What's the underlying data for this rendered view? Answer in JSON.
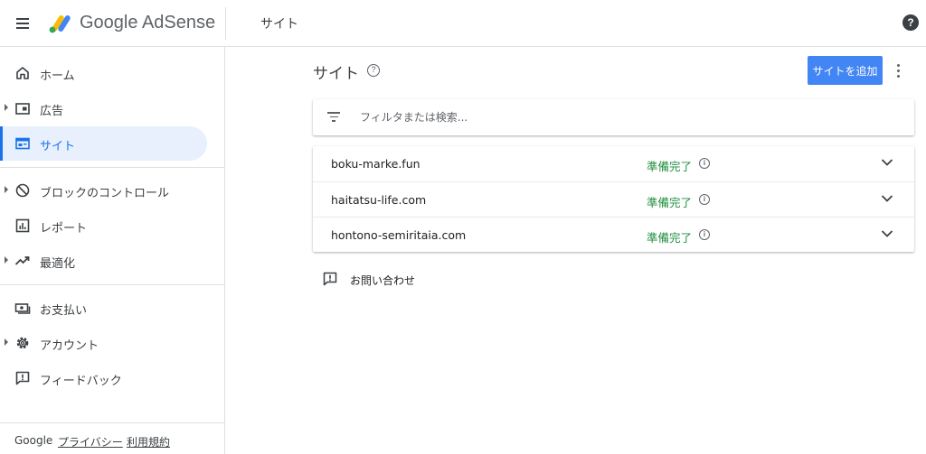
{
  "header": {
    "brand_google": "Google",
    "brand_product": "AdSense",
    "page_title": "サイト",
    "help_label": "?"
  },
  "sidebar": {
    "items": [
      {
        "label": "ホーム",
        "icon": "home-icon",
        "expandable": false,
        "active": false
      },
      {
        "label": "広告",
        "icon": "ads-icon",
        "expandable": true,
        "active": false
      },
      {
        "label": "サイト",
        "icon": "sites-icon",
        "expandable": false,
        "active": true
      },
      {
        "label": "ブロックのコントロール",
        "icon": "block-icon",
        "expandable": true,
        "active": false
      },
      {
        "label": "レポート",
        "icon": "report-icon",
        "expandable": false,
        "active": false
      },
      {
        "label": "最適化",
        "icon": "trending-icon",
        "expandable": true,
        "active": false
      },
      {
        "label": "お支払い",
        "icon": "payment-icon",
        "expandable": false,
        "active": false
      },
      {
        "label": "アカウント",
        "icon": "gear-icon",
        "expandable": true,
        "active": false
      },
      {
        "label": "フィードバック",
        "icon": "feedback-icon",
        "expandable": false,
        "active": false
      }
    ],
    "footer": {
      "google": "Google",
      "privacy": "プライバシー",
      "terms": "利用規約"
    }
  },
  "main": {
    "title": "サイト",
    "title_help": "?",
    "add_button": "サイトを追加",
    "filter_placeholder": "フィルタまたは検索...",
    "sites": [
      {
        "name": "boku-marke.fun",
        "status": "準備完了"
      },
      {
        "name": "haitatsu-life.com",
        "status": "準備完了"
      },
      {
        "name": "hontono-semiritaia.com",
        "status": "準備完了"
      }
    ],
    "feedback_label": "お問い合わせ"
  },
  "colors": {
    "accent": "#1a73e8",
    "button": "#4285f4",
    "status_ok": "#1e8e3e",
    "active_bg": "#e8f0fe"
  }
}
